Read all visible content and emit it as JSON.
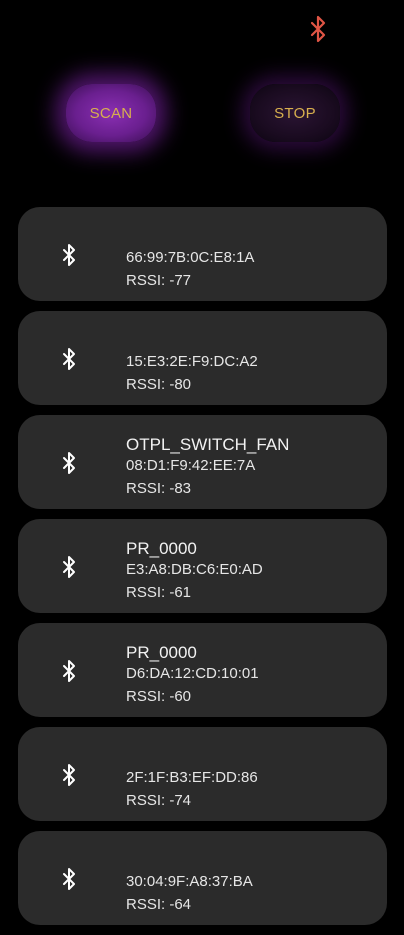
{
  "buttons": {
    "scan_label": "SCAN",
    "stop_label": "STOP"
  },
  "colors": {
    "background": "#000000",
    "card": "#2b2b2b",
    "button_text": "#d8b04e",
    "scan_glow": "#8a2fb3",
    "status_bluetooth": "#e05545"
  },
  "icons": {
    "status": "bluetooth-icon",
    "device": "bluetooth-icon"
  },
  "devices": [
    {
      "name": "",
      "mac": "66:99:7B:0C:E8:1A",
      "rssi": "RSSI: -77"
    },
    {
      "name": "",
      "mac": "15:E3:2E:F9:DC:A2",
      "rssi": "RSSI: -80"
    },
    {
      "name": "OTPL_SWITCH_FAN",
      "mac": "08:D1:F9:42:EE:7A",
      "rssi": "RSSI: -83"
    },
    {
      "name": "PR_0000",
      "mac": "E3:A8:DB:C6:E0:AD",
      "rssi": "RSSI: -61"
    },
    {
      "name": "PR_0000",
      "mac": "D6:DA:12:CD:10:01",
      "rssi": "RSSI: -60"
    },
    {
      "name": "",
      "mac": "2F:1F:B3:EF:DD:86",
      "rssi": "RSSI: -74"
    },
    {
      "name": "",
      "mac": "30:04:9F:A8:37:BA",
      "rssi": "RSSI: -64"
    }
  ]
}
